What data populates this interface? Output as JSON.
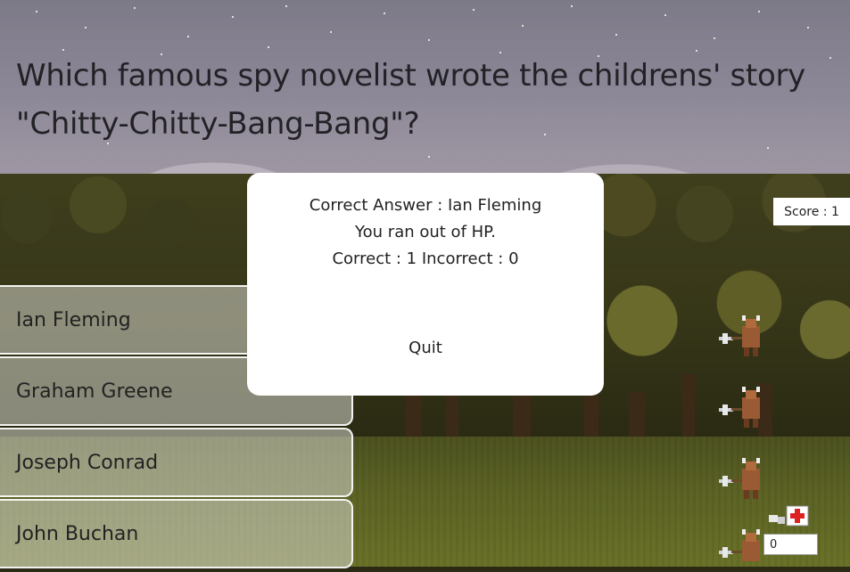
{
  "question": {
    "text": "Which famous spy novelist wrote the childrens' story \"Chitty-Chitty-Bang-Bang\"?"
  },
  "score": {
    "label": "Score : 1"
  },
  "answers": [
    {
      "label": "Ian Fleming"
    },
    {
      "label": "Graham Greene"
    },
    {
      "label": "Joseph Conrad"
    },
    {
      "label": "John Buchan"
    }
  ],
  "modal": {
    "correct_answer": "Correct Answer : Ian Fleming",
    "message": "You ran out of HP.",
    "tally": "Correct : 1 Incorrect : 0",
    "quit_label": "Quit"
  },
  "hp_input": {
    "value": "0"
  },
  "sprites": {
    "enemy_icon": "minotaur-axe-icon",
    "item_icon": "first-aid-icon"
  },
  "colors": {
    "modal_bg": "#ffffff",
    "answer_bg": "rgba(215,215,205,0.55)",
    "text": "#222222"
  }
}
